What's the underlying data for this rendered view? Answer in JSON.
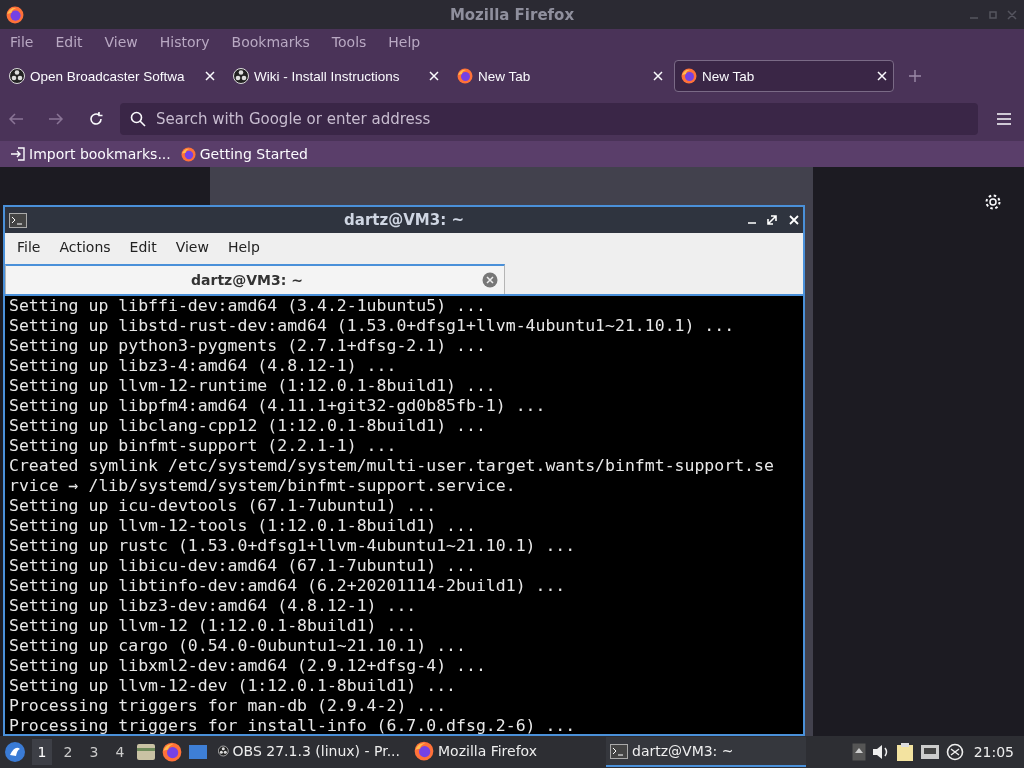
{
  "firefox": {
    "title": "Mozilla Firefox",
    "menu": [
      "File",
      "Edit",
      "View",
      "History",
      "Bookmarks",
      "Tools",
      "Help"
    ],
    "tabs": [
      {
        "label": "Open Broadcaster Softwa",
        "kind": "obs",
        "selected": false
      },
      {
        "label": "Wiki - Install Instructions",
        "kind": "obs",
        "selected": false
      },
      {
        "label": "New Tab",
        "kind": "firefox",
        "selected": false
      },
      {
        "label": "New Tab",
        "kind": "firefox",
        "selected": true
      }
    ],
    "address": {
      "placeholder": "Search with Google or enter address"
    },
    "bookmarks": [
      {
        "label": "Import bookmarks...",
        "kind": "import"
      },
      {
        "label": "Getting Started",
        "kind": "firefox"
      }
    ]
  },
  "terminal": {
    "title": "dartz@VM3: ~",
    "menu": [
      "File",
      "Actions",
      "Edit",
      "View",
      "Help"
    ],
    "tabs": [
      {
        "label": "dartz@VM3: ~",
        "selected": true
      }
    ],
    "lines": [
      "Setting up libffi-dev:amd64 (3.4.2-1ubuntu5) ...",
      "Setting up libstd-rust-dev:amd64 (1.53.0+dfsg1+llvm-4ubuntu1~21.10.1) ...",
      "Setting up python3-pygments (2.7.1+dfsg-2.1) ...",
      "Setting up libz3-4:amd64 (4.8.12-1) ...",
      "Setting up llvm-12-runtime (1:12.0.1-8build1) ...",
      "Setting up libpfm4:amd64 (4.11.1+git32-gd0b85fb-1) ...",
      "Setting up libclang-cpp12 (1:12.0.1-8build1) ...",
      "Setting up binfmt-support (2.2.1-1) ...",
      "Created symlink /etc/systemd/system/multi-user.target.wants/binfmt-support.se",
      "rvice → /lib/systemd/system/binfmt-support.service.",
      "Setting up icu-devtools (67.1-7ubuntu1) ...",
      "Setting up llvm-12-tools (1:12.0.1-8build1) ...",
      "Setting up rustc (1.53.0+dfsg1+llvm-4ubuntu1~21.10.1) ...",
      "Setting up libicu-dev:amd64 (67.1-7ubuntu1) ...",
      "Setting up libtinfo-dev:amd64 (6.2+20201114-2build1) ...",
      "Setting up libz3-dev:amd64 (4.8.12-1) ...",
      "Setting up llvm-12 (1:12.0.1-8build1) ...",
      "Setting up cargo (0.54.0-0ubuntu1~21.10.1) ...",
      "Setting up libxml2-dev:amd64 (2.9.12+dfsg-4) ...",
      "Setting up llvm-12-dev (1:12.0.1-8build1) ...",
      "Processing triggers for man-db (2.9.4-2) ...",
      "Processing triggers for install-info (6.7.0.dfsg.2-6) ..."
    ]
  },
  "taskbar": {
    "workspaces": [
      {
        "label": "1",
        "selected": true
      },
      {
        "label": "2",
        "selected": false
      },
      {
        "label": "3",
        "selected": false
      },
      {
        "label": "4",
        "selected": false
      }
    ],
    "windows": [
      {
        "label": "OBS 27.1.3 (linux) - Pr...",
        "kind": "obs",
        "selected": false
      },
      {
        "label": "Mozilla Firefox",
        "kind": "firefox",
        "selected": false
      },
      {
        "label": "dartz@VM3: ~",
        "kind": "terminal",
        "selected": true
      }
    ],
    "clock": "21:05"
  }
}
